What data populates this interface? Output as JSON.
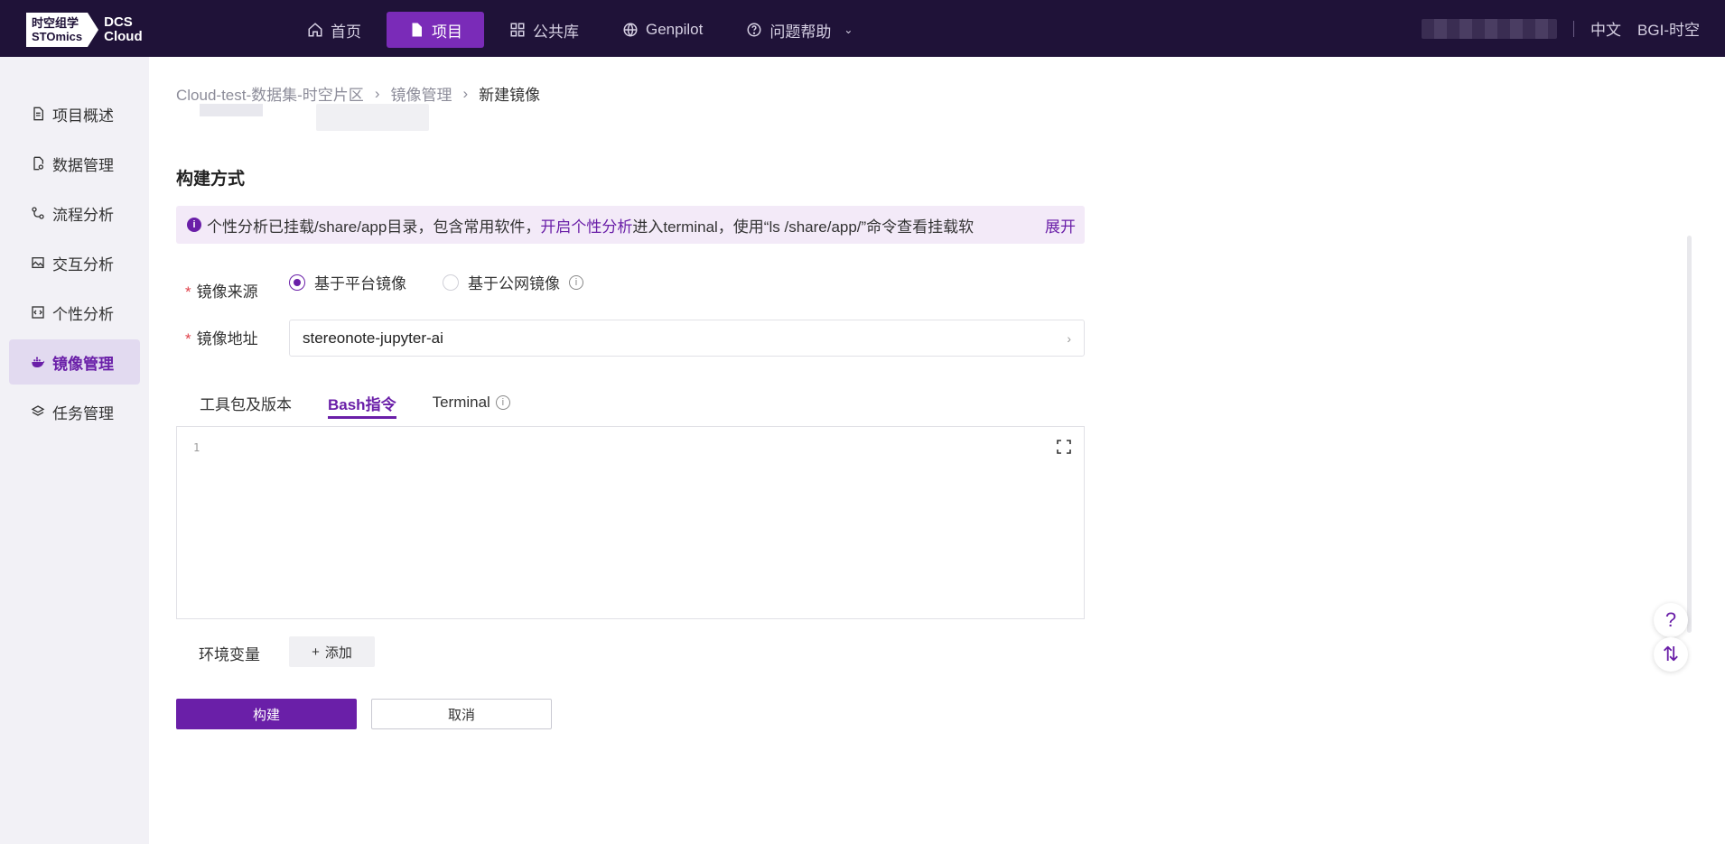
{
  "app": {
    "logo_line1": "时空组学",
    "logo_line2": "STOmics",
    "logo_dcs1": "DCS",
    "logo_dcs2": "Cloud"
  },
  "nav": {
    "items": [
      {
        "label": "首页",
        "icon": "home-icon"
      },
      {
        "label": "项目",
        "icon": "document-icon"
      },
      {
        "label": "公共库",
        "icon": "grid-icon"
      },
      {
        "label": "Genpilot",
        "icon": "globe-icon"
      },
      {
        "label": "问题帮助",
        "icon": "help-circle-icon"
      }
    ],
    "language": "中文",
    "org": "BGI-时空"
  },
  "sidebar": {
    "items": [
      {
        "label": "项目概述",
        "icon": "file-text-icon"
      },
      {
        "label": "数据管理",
        "icon": "file-search-icon"
      },
      {
        "label": "流程分析",
        "icon": "flow-icon"
      },
      {
        "label": "交互分析",
        "icon": "image-icon"
      },
      {
        "label": "个性分析",
        "icon": "code-icon"
      },
      {
        "label": "镜像管理",
        "icon": "docker-icon"
      },
      {
        "label": "任务管理",
        "icon": "layers-icon"
      }
    ],
    "active": "镜像管理"
  },
  "breadcrumb": {
    "items": [
      "Cloud-test-数据集-时空片区",
      "镜像管理",
      "新建镜像"
    ]
  },
  "form": {
    "section_title": "构建方式",
    "notice": {
      "text_before": "个性分析已挂载/share/app目录，包含常用软件，",
      "link": "开启个性分析",
      "text_after": "进入terminal，使用“ls /share/app/”命令查看挂载软",
      "expand": "展开"
    },
    "source_label": "镜像来源",
    "source_options": [
      "基于平台镜像",
      "基于公网镜像"
    ],
    "source_selected": "基于平台镜像",
    "address_label": "镜像地址",
    "address_value": "stereonote-jupyter-ai",
    "tabs": [
      "工具包及版本",
      "Bash指令",
      "Terminal"
    ],
    "active_tab": "Bash指令",
    "editor_line": "1",
    "env_label": "环境变量",
    "add_label": "添加",
    "build_label": "构建",
    "cancel_label": "取消"
  },
  "colors": {
    "brand": "#6a1fa8",
    "topbar": "#1f1238",
    "sidebar_bg": "#f2f1f6",
    "required": "#e0424b"
  }
}
